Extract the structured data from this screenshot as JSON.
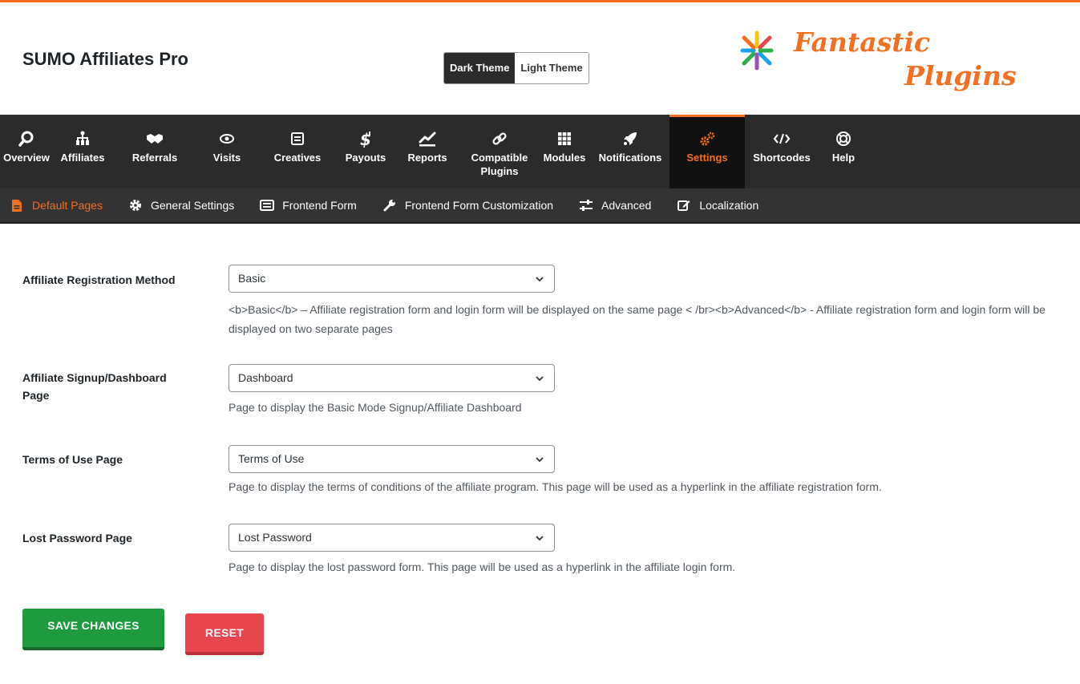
{
  "app": {
    "title": "SUMO Affiliates Pro"
  },
  "theme": {
    "dark_label": "Dark Theme",
    "light_label": "Light Theme",
    "selected": "Dark Theme"
  },
  "logo": {
    "line1": "Fantastic",
    "line2": "Plugins"
  },
  "colors": {
    "accent": "#f36f21",
    "nav_bg": "#2b2b2b",
    "subnav_bg": "#333333",
    "save": "#1e9b3f",
    "reset": "#e8464f"
  },
  "mainnav": [
    {
      "label": "Overview",
      "icon": "search-icon"
    },
    {
      "label": "Affiliates",
      "icon": "org-chart-icon"
    },
    {
      "label": "Referrals",
      "icon": "handshake-icon"
    },
    {
      "label": "Visits",
      "icon": "eye-icon"
    },
    {
      "label": "Creatives",
      "icon": "image-frame-icon"
    },
    {
      "label": "Payouts",
      "icon": "dollar-icon"
    },
    {
      "label": "Reports",
      "icon": "line-chart-icon"
    },
    {
      "label": "Compatible Plugins",
      "icon": "link-icon"
    },
    {
      "label": "Modules",
      "icon": "grid-icon"
    },
    {
      "label": "Notifications",
      "icon": "rocket-icon"
    },
    {
      "label": "Settings",
      "icon": "gears-icon",
      "active": true
    },
    {
      "label": "Shortcodes",
      "icon": "code-icon"
    },
    {
      "label": "Help",
      "icon": "lifebuoy-icon"
    }
  ],
  "subnav": [
    {
      "label": "Default Pages",
      "icon": "document-icon",
      "active": true
    },
    {
      "label": "General Settings",
      "icon": "gear-icon"
    },
    {
      "label": "Frontend Form",
      "icon": "form-icon"
    },
    {
      "label": "Frontend Form Customization",
      "icon": "wrench-icon"
    },
    {
      "label": "Advanced",
      "icon": "sliders-icon"
    },
    {
      "label": "Localization",
      "icon": "edit-icon"
    }
  ],
  "fields": [
    {
      "label": "Affiliate Registration Method",
      "value": "Basic",
      "desc": "<b>Basic</b> – Affiliate registration form and login form will be displayed on the same page < /br><b>Advanced</b> - Affiliate registration form and login form will be displayed on two separate pages"
    },
    {
      "label": "Affiliate Signup/Dashboard Page",
      "value": "Dashboard",
      "desc": "Page to display the Basic Mode Signup/Affiliate Dashboard"
    },
    {
      "label": "Terms of Use Page",
      "value": "Terms of Use",
      "desc": "Page to display the terms of conditions of the affiliate program. This page will be used as a hyperlink in the affiliate registration form."
    },
    {
      "label": "Lost Password Page",
      "value": "Lost Password",
      "desc": "Page to display the lost password form. This page will be used as a hyperlink in the affiliate login form."
    }
  ],
  "buttons": {
    "save": "SAVE CHANGES",
    "reset": "RESET"
  }
}
